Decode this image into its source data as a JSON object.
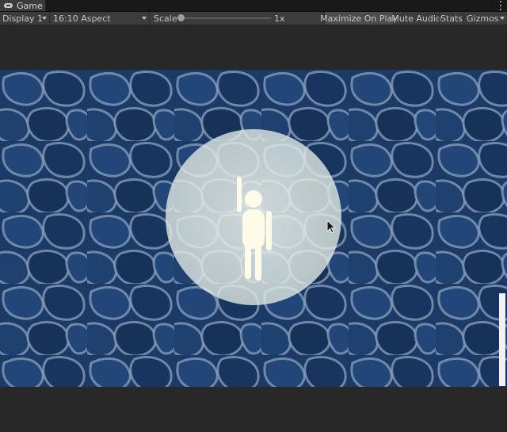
{
  "tab": {
    "title": "Game",
    "icon": "gamepad-icon"
  },
  "toolbar": {
    "display": "Display 1",
    "aspect": "16:10 Aspect",
    "scale_label": "Scale",
    "scale_value": "1x",
    "maximize": "Maximize On Play",
    "mute": "Mute Audio",
    "stats": "Stats",
    "gizmos": "Gizmos"
  },
  "colors": {
    "water": "#1b3a66",
    "caustic": "#8aa0bd",
    "spotlight": "#e4ede6",
    "character": "#fffbe9"
  }
}
